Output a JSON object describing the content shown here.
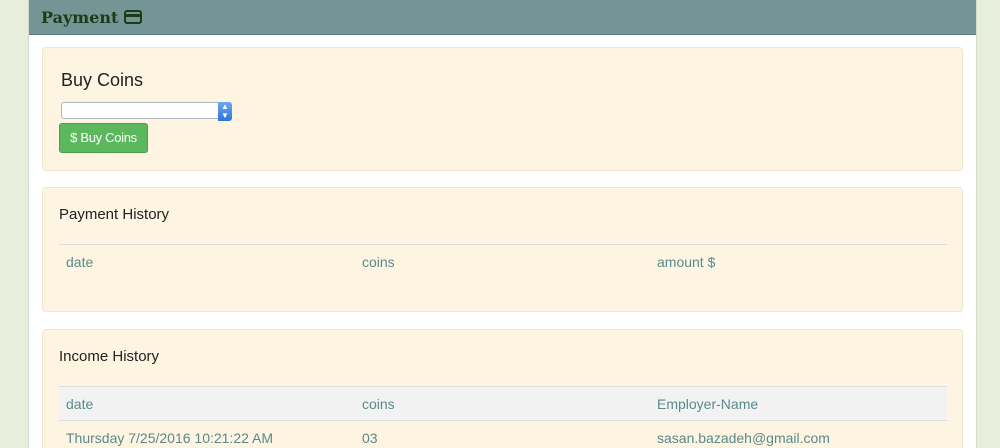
{
  "header": {
    "title": "Payment",
    "icon": "credit-card-icon"
  },
  "buy_coins": {
    "title": "Buy Coins",
    "select_value": "",
    "button_label": "$ Buy Coins"
  },
  "payment_history": {
    "title": "Payment History",
    "columns": [
      "date",
      "coins",
      "amount $"
    ],
    "rows": []
  },
  "income_history": {
    "title": "Income History",
    "columns": [
      "date",
      "coins",
      "Employer-Name"
    ],
    "rows": [
      [
        "Thursday 7/25/2016 10:21:22 AM",
        "03",
        "sasan.bazadeh@gmail.com"
      ]
    ]
  },
  "colors": {
    "header_bg": "#739596",
    "panel_bg": "#fdf4e2",
    "button_green": "#5cb85c",
    "table_text": "#5a8a8c"
  }
}
